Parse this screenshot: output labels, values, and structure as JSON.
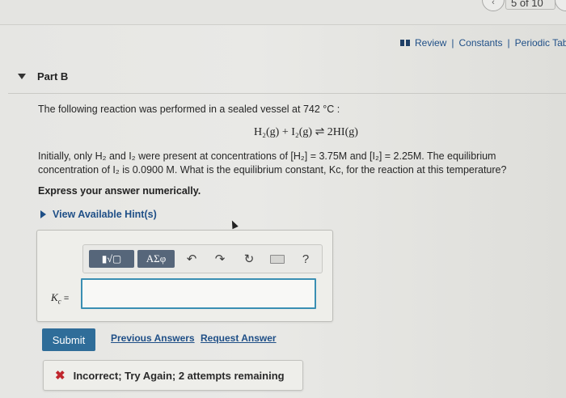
{
  "nav": {
    "page_counter": "5 of 10"
  },
  "links": {
    "review": "Review",
    "constants": "Constants",
    "periodic_table": "Periodic Table",
    "separator": "|"
  },
  "part": {
    "title": "Part B"
  },
  "question": {
    "intro": "The following reaction was performed in a sealed vessel at 742 °C :",
    "equation": "H₂(g) + I₂(g) ⇌ 2HI(g)",
    "body_line1": "Initially, only H₂ and I₂ were present at concentrations of [H₂] = 3.75M and [I₂] = 2.25M. The equilibrium",
    "body_line2": "concentration of I₂ is 0.0900 M. What is the equilibrium constant, Kc, for the reaction at this temperature?",
    "instruction": "Express your answer numerically."
  },
  "hints": {
    "label": "View Available Hint(s)"
  },
  "toolbar": {
    "templates": "▮√▢",
    "symbols": "ΑΣφ",
    "help": "?"
  },
  "answer": {
    "label_var": "K",
    "label_sub": "c",
    "label_eq": "=",
    "value": ""
  },
  "actions": {
    "submit": "Submit",
    "previous_answers": "Previous Answers",
    "request_answer": "Request Answer"
  },
  "feedback": {
    "text": "Incorrect; Try Again; 2 attempts remaining",
    "status_color": "#c0262d"
  }
}
